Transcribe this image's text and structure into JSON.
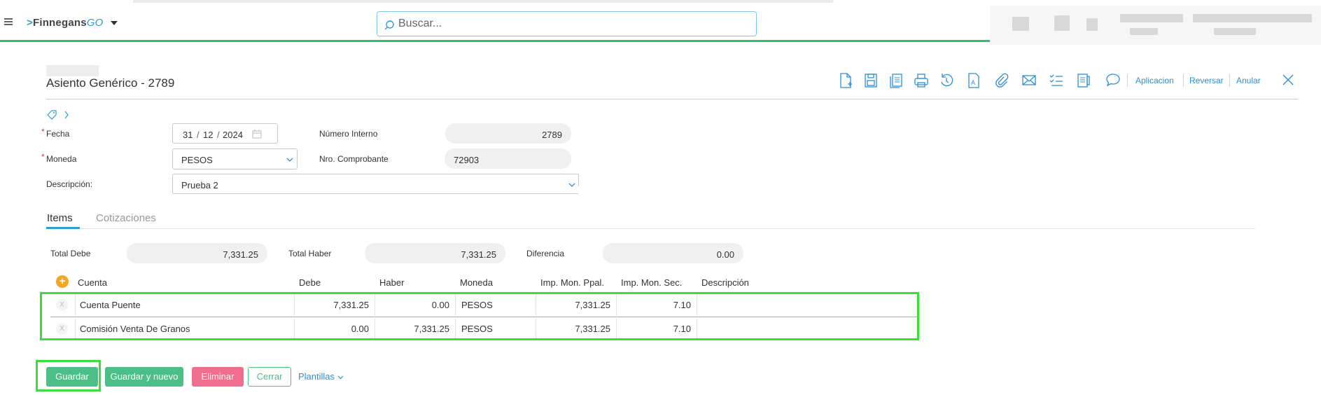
{
  "header": {
    "logo_main": "Finnegans",
    "logo_go": "GO",
    "search_placeholder": "Buscar..."
  },
  "page": {
    "title": "Asiento Genérico - 2789"
  },
  "toolbar": {
    "icons": [
      "new-document-icon",
      "save-icon",
      "copy-icon",
      "print-icon",
      "history-icon",
      "report-icon",
      "attachment-icon",
      "email-icon",
      "checklist-icon",
      "notes-icon",
      "comment-icon"
    ],
    "links": [
      "Aplicacion",
      "Reversar",
      "Anular"
    ]
  },
  "form": {
    "fecha_label": "Fecha",
    "fecha_day": "31",
    "fecha_month": "12",
    "fecha_year": "2024",
    "numero_interno_label": "Número Interno",
    "numero_interno_value": "2789",
    "moneda_label": "Moneda",
    "moneda_value": "PESOS",
    "nro_comprobante_label": "Nro. Comprobante",
    "nro_comprobante_value": "72903",
    "descripcion_label": "Descripción:",
    "descripcion_value": "Prueba 2"
  },
  "tabs": [
    "Items",
    "Cotizaciones"
  ],
  "totals": {
    "total_debe_label": "Total Debe",
    "total_debe_value": "7,331.25",
    "total_haber_label": "Total Haber",
    "total_haber_value": "7,331.25",
    "diferencia_label": "Diferencia",
    "diferencia_value": "0.00"
  },
  "table": {
    "headers": [
      "Cuenta",
      "Debe",
      "Haber",
      "Moneda",
      "Imp. Mon. Ppal.",
      "Imp. Mon. Sec.",
      "Descripción"
    ],
    "rows": [
      {
        "cuenta": "Cuenta Puente",
        "debe": "7,331.25",
        "haber": "0.00",
        "moneda": "PESOS",
        "ppal": "7,331.25",
        "sec": "7.10",
        "descripcion": ""
      },
      {
        "cuenta": "Comisión Venta De Granos",
        "debe": "0.00",
        "haber": "7,331.25",
        "moneda": "PESOS",
        "ppal": "7,331.25",
        "sec": "7.10",
        "descripcion": ""
      }
    ],
    "delete_glyph": "X",
    "add_glyph": "+"
  },
  "actions": {
    "guardar": "Guardar",
    "guardar_nuevo": "Guardar y nuevo",
    "eliminar": "Eliminar",
    "cerrar": "Cerrar",
    "plantillas": "Plantillas"
  },
  "colors": {
    "accent_blue": "#2a9fd6",
    "green": "#4cbf86",
    "header_bar": "#2fbf71",
    "danger": "#f06f8f",
    "highlight": "#39e03b"
  }
}
